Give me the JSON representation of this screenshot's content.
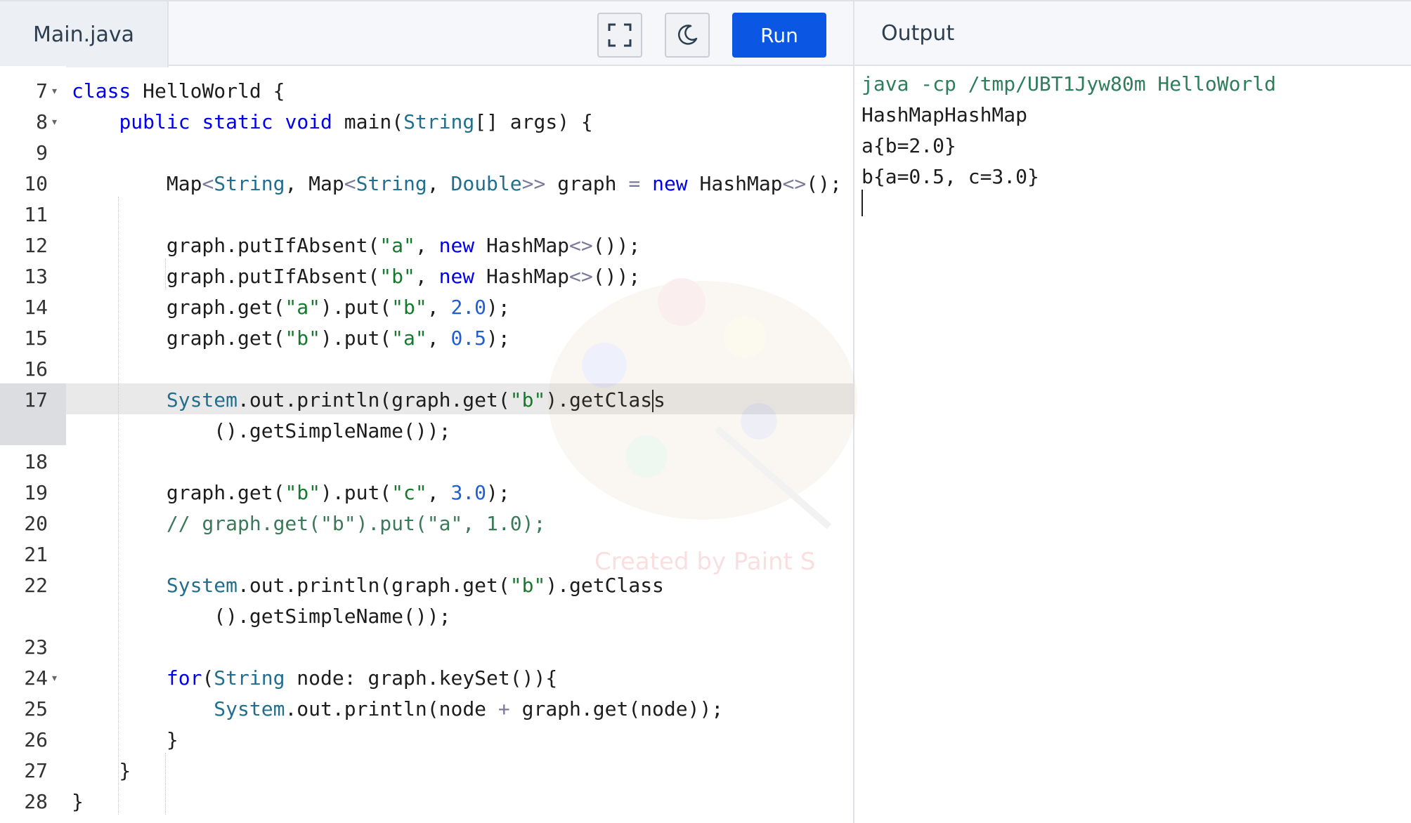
{
  "editor": {
    "file_tab": "Main.java",
    "run_label": "Run",
    "fullscreen_icon": "fullscreen-icon",
    "theme_icon": "moon-icon",
    "line_numbers": [
      "7",
      "8",
      "9",
      "10",
      "11",
      "12",
      "13",
      "14",
      "15",
      "16",
      "17",
      "18",
      "19",
      "20",
      "21",
      "22",
      "23",
      "24",
      "25",
      "26",
      "27",
      "28"
    ],
    "active_line": "17"
  },
  "output": {
    "title": "Output",
    "lines": [
      "java -cp /tmp/UBT1Jyw80m HelloWorld",
      "HashMapHashMap",
      "a{b=2.0}",
      "b{a=0.5, c=3.0}"
    ]
  },
  "watermark": {
    "text": "Created by Paint S"
  },
  "colors": {
    "run_button": "#0b57e3",
    "keyword": "#0000ee",
    "string": "#157a2d",
    "number": "#1f5fd1",
    "comment": "#3a7a5a",
    "output_command": "#2e7d5b"
  }
}
